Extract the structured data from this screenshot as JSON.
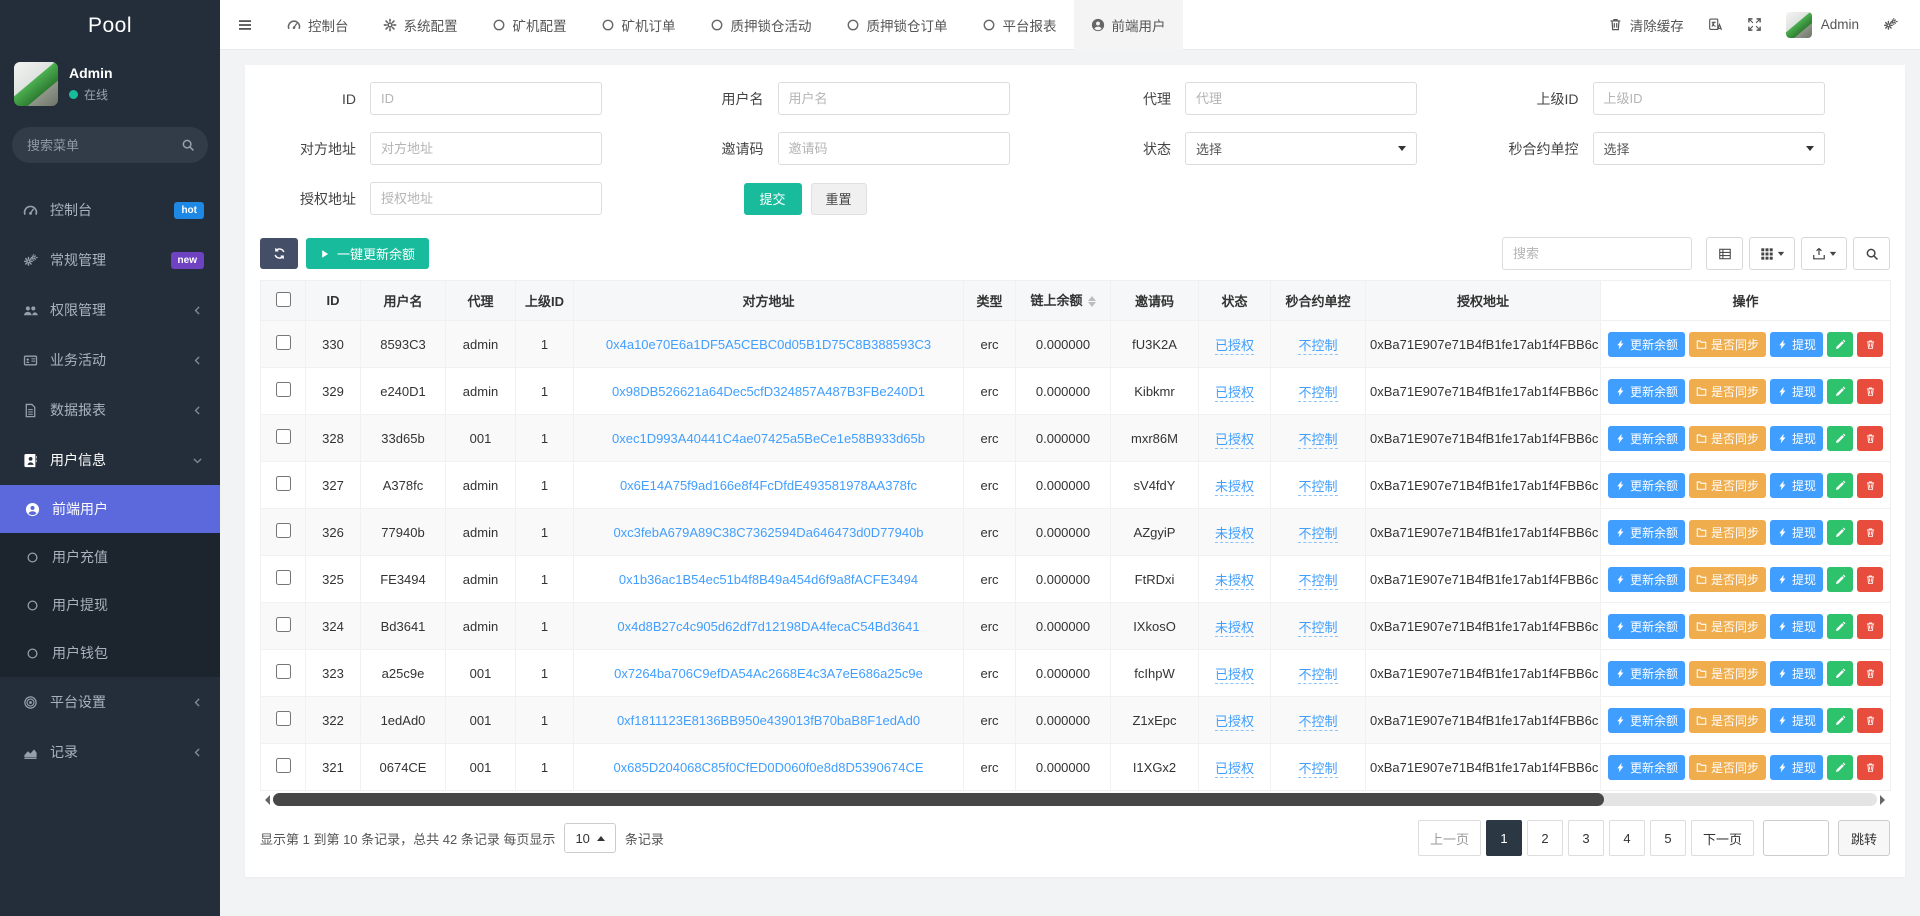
{
  "sidebar": {
    "brand": "Pool",
    "user": {
      "name": "Admin",
      "status": "在线"
    },
    "search_placeholder": "搜索菜单",
    "menu": [
      {
        "key": "console",
        "icon": "dashboard",
        "label": "控制台",
        "badge": "hot",
        "badge_color": "#1e88e5"
      },
      {
        "key": "general",
        "icon": "cogs",
        "label": "常规管理",
        "badge": "new",
        "badge_color": "#6f42c1"
      },
      {
        "key": "permission",
        "icon": "users",
        "label": "权限管理",
        "arrow": "left"
      },
      {
        "key": "business",
        "icon": "card",
        "label": "业务活动",
        "arrow": "left"
      },
      {
        "key": "report",
        "icon": "file",
        "label": "数据报表",
        "arrow": "left"
      },
      {
        "key": "user-info",
        "icon": "book",
        "label": "用户信息",
        "arrow": "down",
        "open": true
      }
    ],
    "submenu": [
      {
        "key": "front-user",
        "label": "前端用户",
        "active": true
      },
      {
        "key": "user-recharge",
        "label": "用户充值"
      },
      {
        "key": "user-withdraw",
        "label": "用户提现"
      },
      {
        "key": "user-wallet",
        "label": "用户钱包"
      }
    ],
    "menu_bottom": [
      {
        "key": "platform-settings",
        "icon": "bullseye",
        "label": "平台设置",
        "arrow": "left"
      },
      {
        "key": "log",
        "icon": "chart",
        "label": "记录",
        "arrow": "left"
      }
    ]
  },
  "topnav": {
    "tabs": [
      {
        "key": "console",
        "icon": "dashboard",
        "label": "控制台"
      },
      {
        "key": "system-config",
        "icon": "gear",
        "label": "系统配置"
      },
      {
        "key": "miner-config",
        "icon": "circle",
        "label": "矿机配置"
      },
      {
        "key": "miner-order",
        "icon": "circle",
        "label": "矿机订单"
      },
      {
        "key": "pledge-activity",
        "icon": "circle",
        "label": "质押锁仓活动"
      },
      {
        "key": "pledge-order",
        "icon": "circle",
        "label": "质押锁仓订单"
      },
      {
        "key": "platform-report",
        "icon": "circle",
        "label": "平台报表"
      },
      {
        "key": "front-user",
        "icon": "user",
        "label": "前端用户",
        "active": true
      }
    ],
    "clear_cache": "清除缓存",
    "username": "Admin"
  },
  "filters": {
    "id": {
      "label": "ID",
      "placeholder": "ID"
    },
    "username": {
      "label": "用户名",
      "placeholder": "用户名"
    },
    "agent": {
      "label": "代理",
      "placeholder": "代理"
    },
    "parent_id": {
      "label": "上级ID",
      "placeholder": "上级ID"
    },
    "address": {
      "label": "对方地址",
      "placeholder": "对方地址"
    },
    "invite_code": {
      "label": "邀请码",
      "placeholder": "邀请码"
    },
    "status": {
      "label": "状态",
      "placeholder": "选择"
    },
    "contract_control": {
      "label": "秒合约单控",
      "placeholder": "选择"
    },
    "auth_address": {
      "label": "授权地址",
      "placeholder": "授权地址"
    },
    "submit": "提交",
    "reset": "重置"
  },
  "toolbar": {
    "update_all_label": "一键更新余额",
    "search_placeholder": "搜索"
  },
  "table": {
    "headers": [
      {
        "key": "id",
        "label": "ID"
      },
      {
        "key": "username",
        "label": "用户名"
      },
      {
        "key": "agent",
        "label": "代理"
      },
      {
        "key": "parent",
        "label": "上级ID"
      },
      {
        "key": "address",
        "label": "对方地址"
      },
      {
        "key": "type",
        "label": "类型"
      },
      {
        "key": "balance",
        "label": "链上余额",
        "sortable": true
      },
      {
        "key": "invite",
        "label": "邀请码"
      },
      {
        "key": "status",
        "label": "状态"
      },
      {
        "key": "control",
        "label": "秒合约单控"
      },
      {
        "key": "auth",
        "label": "授权地址"
      },
      {
        "key": "ops",
        "label": "操作"
      }
    ],
    "auth_address_display": "0xBa71E907e71B4fB1fe17ab1f4FBB6c",
    "actions": {
      "update_balance": "更新余额",
      "sync": "是否同步",
      "withdraw": "提现"
    },
    "rows": [
      {
        "id": "330",
        "username": "8593C3",
        "agent": "admin",
        "parent_id": "1",
        "address": "0x4a10e70E6a1DF5A5CEBC0d05B1D75C8B388593C3",
        "type": "erc",
        "balance": "0.000000",
        "invite_code": "fU3K2A",
        "status": "已授权",
        "control": "不控制"
      },
      {
        "id": "329",
        "username": "e240D1",
        "agent": "admin",
        "parent_id": "1",
        "address": "0x98DB526621a64Dec5cfD324857A487B3FBe240D1",
        "type": "erc",
        "balance": "0.000000",
        "invite_code": "Kibkmr",
        "status": "已授权",
        "control": "不控制"
      },
      {
        "id": "328",
        "username": "33d65b",
        "agent": "001",
        "parent_id": "1",
        "address": "0xec1D993A40441C4ae07425a5BeCe1e58B933d65b",
        "type": "erc",
        "balance": "0.000000",
        "invite_code": "mxr86M",
        "status": "已授权",
        "control": "不控制"
      },
      {
        "id": "327",
        "username": "A378fc",
        "agent": "admin",
        "parent_id": "1",
        "address": "0x6E14A75f9ad166e8f4FcDfdE493581978AA378fc",
        "type": "erc",
        "balance": "0.000000",
        "invite_code": "sV4fdY",
        "status": "未授权",
        "control": "不控制"
      },
      {
        "id": "326",
        "username": "77940b",
        "agent": "admin",
        "parent_id": "1",
        "address": "0xc3febA679A89C38C7362594Da646473d0D77940b",
        "type": "erc",
        "balance": "0.000000",
        "invite_code": "AZgyiP",
        "status": "未授权",
        "control": "不控制"
      },
      {
        "id": "325",
        "username": "FE3494",
        "agent": "admin",
        "parent_id": "1",
        "address": "0x1b36ac1B54ec51b4f8B49a454d6f9a8fACFE3494",
        "type": "erc",
        "balance": "0.000000",
        "invite_code": "FtRDxi",
        "status": "未授权",
        "control": "不控制"
      },
      {
        "id": "324",
        "username": "Bd3641",
        "agent": "admin",
        "parent_id": "1",
        "address": "0x4d8B27c4c905d62df7d12198DA4fecaC54Bd3641",
        "type": "erc",
        "balance": "0.000000",
        "invite_code": "IXkosO",
        "status": "未授权",
        "control": "不控制"
      },
      {
        "id": "323",
        "username": "a25c9e",
        "agent": "001",
        "parent_id": "1",
        "address": "0x7264ba706C9efDA54Ac2668E4c3A7eE686a25c9e",
        "type": "erc",
        "balance": "0.000000",
        "invite_code": "fcIhpW",
        "status": "已授权",
        "control": "不控制"
      },
      {
        "id": "322",
        "username": "1edAd0",
        "agent": "001",
        "parent_id": "1",
        "address": "0xf1811123E8136BB950e439013fB70baB8F1edAd0",
        "type": "erc",
        "balance": "0.000000",
        "invite_code": "Z1xEpc",
        "status": "已授权",
        "control": "不控制"
      },
      {
        "id": "321",
        "username": "0674CE",
        "agent": "001",
        "parent_id": "1",
        "address": "0x685D204068C85f0CfED0D060f0e8d8D5390674CE",
        "type": "erc",
        "balance": "0.000000",
        "invite_code": "I1XGx2",
        "status": "已授权",
        "control": "不控制"
      }
    ]
  },
  "pagination": {
    "summary_prefix": "显示第 1 到第 10 条记录，总共 42 条记录 每页显示",
    "page_size": "10",
    "summary_suffix": "条记录",
    "prev": "上一页",
    "next": "下一页",
    "pages": [
      "1",
      "2",
      "3",
      "4",
      "5"
    ],
    "active_page": "1",
    "jump": "跳转"
  }
}
